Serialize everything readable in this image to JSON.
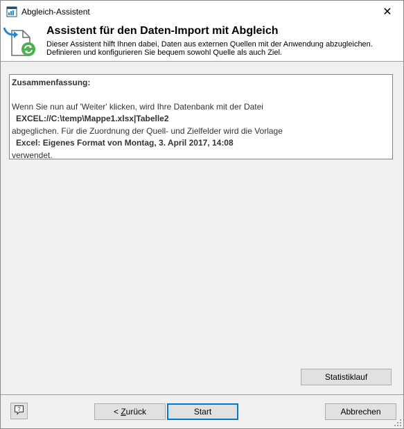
{
  "window": {
    "title": "Abgleich-Assistent",
    "close_label": "✕"
  },
  "header": {
    "title": "Assistent für den Daten-Import mit Abgleich",
    "description": "Dieser Assistent hilft Ihnen dabei, Daten aus externen Quellen mit der Anwendung abzugleichen. Definieren und konfigurieren Sie bequem sowohl Quelle als auch Ziel."
  },
  "summary": {
    "heading": "Zusammenfassung:",
    "line1": "Wenn Sie nun auf 'Weiter' klicken, wird Ihre Datenbank mit der Datei",
    "source": "EXCEL://C:\\temp\\Mappe1.xlsx|Tabelle2",
    "line2": "abgeglichen. Für die Zuordnung der Quell- und Zielfelder wird die Vorlage",
    "template": "Excel: Eigenes Format von Montag, 3. April 2017, 14:08",
    "line3": "verwendet."
  },
  "buttons": {
    "statistics": "Statistiklauf",
    "back_prefix": "< ",
    "back_accel": "Z",
    "back_rest": "urück",
    "start": "Start",
    "cancel": "Abbrechen",
    "help": "?"
  },
  "colors": {
    "accent": "#0078d7",
    "icon_blue": "#1e88d8",
    "icon_green": "#4caf50"
  }
}
